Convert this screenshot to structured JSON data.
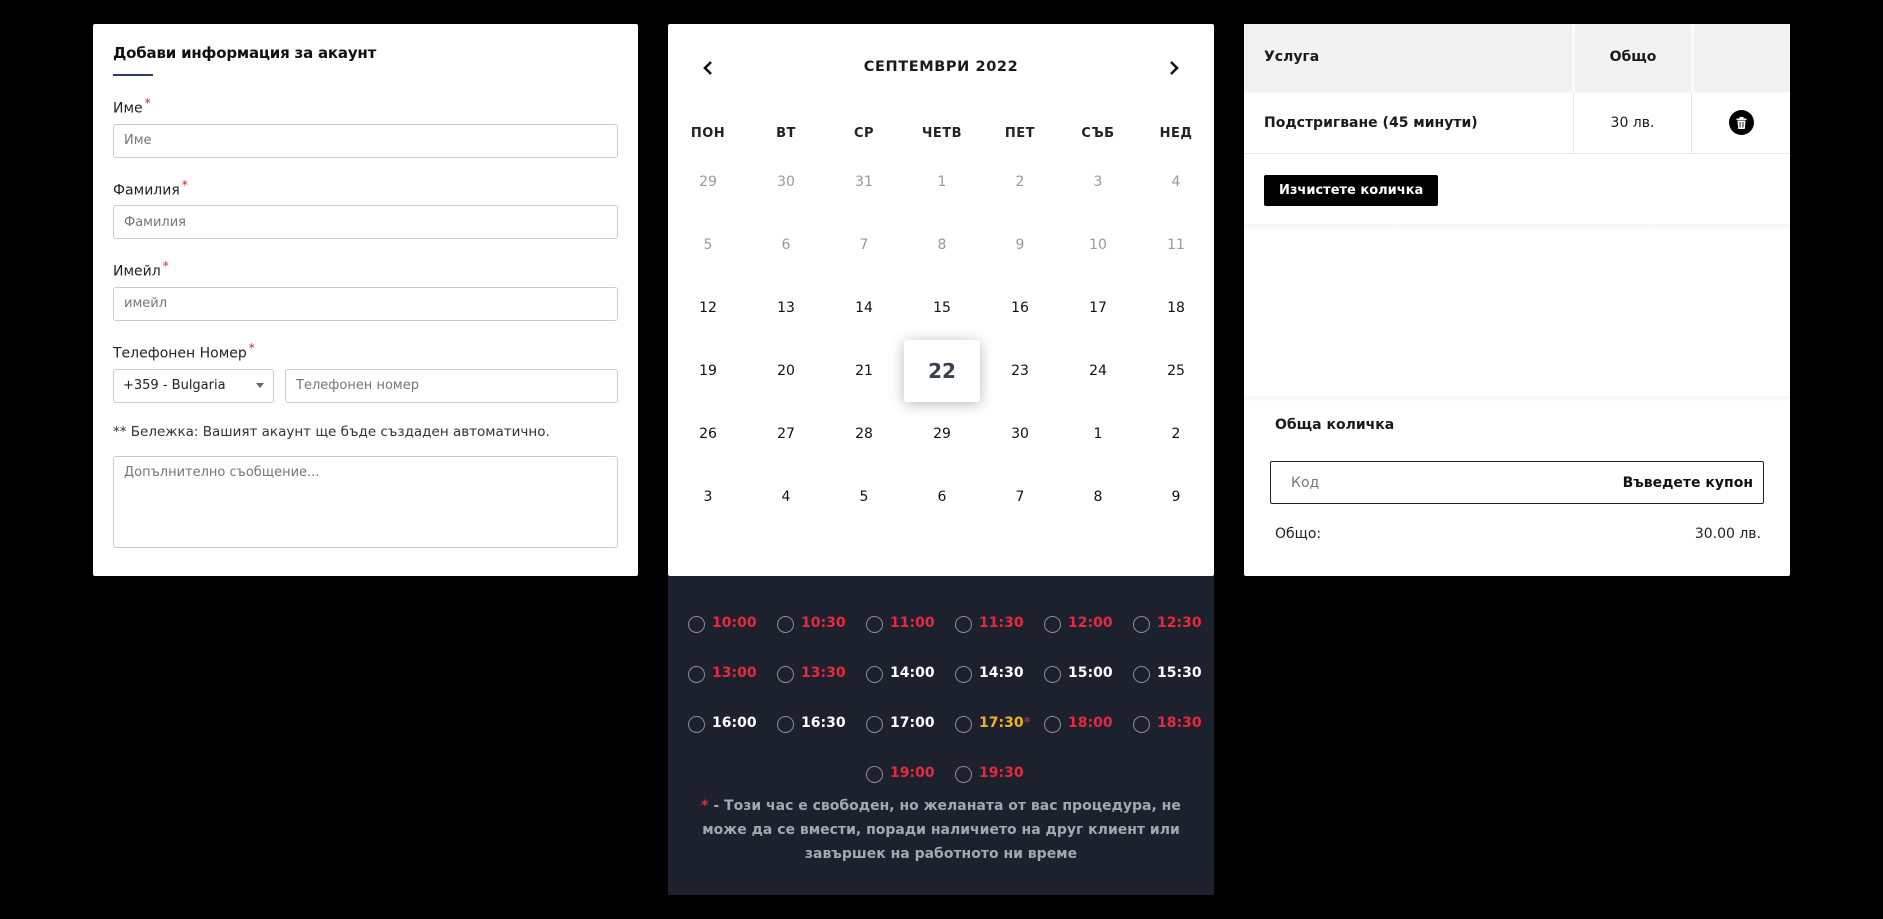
{
  "account": {
    "title": "Добави информация за акаунт",
    "required_mark": "*",
    "first_name": {
      "label": "Име",
      "placeholder": "Име"
    },
    "last_name": {
      "label": "Фамилия",
      "placeholder": "Фамилия"
    },
    "email": {
      "label": "Имейл",
      "placeholder": "имейл"
    },
    "phone": {
      "label": "Телефонен Номер",
      "country_value": "+359 - Bulgaria",
      "placeholder": "Телефонен номер"
    },
    "note": "** Бележка: Вашият акаунт ще бъде създаден автоматично.",
    "message_placeholder": "Допълнително съобщение..."
  },
  "calendar": {
    "month_label": "СЕПТЕМВРИ 2022",
    "weekdays": [
      "ПОН",
      "ВТ",
      "СР",
      "ЧЕТВ",
      "ПЕТ",
      "СЪБ",
      "НЕД"
    ],
    "selected_day": "22",
    "weeks": [
      [
        {
          "d": "29",
          "m": true
        },
        {
          "d": "30",
          "m": true
        },
        {
          "d": "31",
          "m": true
        },
        {
          "d": "1",
          "m": true
        },
        {
          "d": "2",
          "m": true
        },
        {
          "d": "3",
          "m": true
        },
        {
          "d": "4",
          "m": true
        }
      ],
      [
        {
          "d": "5",
          "m": true
        },
        {
          "d": "6",
          "m": true
        },
        {
          "d": "7",
          "m": true
        },
        {
          "d": "8",
          "m": true
        },
        {
          "d": "9",
          "m": true
        },
        {
          "d": "10",
          "m": true
        },
        {
          "d": "11",
          "m": true
        }
      ],
      [
        {
          "d": "12"
        },
        {
          "d": "13"
        },
        {
          "d": "14"
        },
        {
          "d": "15"
        },
        {
          "d": "16"
        },
        {
          "d": "17"
        },
        {
          "d": "18"
        }
      ],
      [
        {
          "d": "19"
        },
        {
          "d": "20"
        },
        {
          "d": "21"
        },
        {
          "d": "22",
          "sel": true
        },
        {
          "d": "23"
        },
        {
          "d": "24"
        },
        {
          "d": "25"
        }
      ],
      [
        {
          "d": "26"
        },
        {
          "d": "27"
        },
        {
          "d": "28"
        },
        {
          "d": "29"
        },
        {
          "d": "30"
        },
        {
          "d": "1"
        },
        {
          "d": "2"
        }
      ],
      [
        {
          "d": "3"
        },
        {
          "d": "4"
        },
        {
          "d": "5"
        },
        {
          "d": "6"
        },
        {
          "d": "7"
        },
        {
          "d": "8"
        },
        {
          "d": "9"
        }
      ]
    ]
  },
  "time_slots": {
    "rows": [
      [
        {
          "t": "10:00",
          "s": "busy"
        },
        {
          "t": "10:30",
          "s": "busy"
        },
        {
          "t": "11:00",
          "s": "busy"
        },
        {
          "t": "11:30",
          "s": "busy"
        },
        {
          "t": "12:00",
          "s": "busy"
        },
        {
          "t": "12:30",
          "s": "busy"
        }
      ],
      [
        {
          "t": "13:00",
          "s": "busy"
        },
        {
          "t": "13:30",
          "s": "busy"
        },
        {
          "t": "14:00",
          "s": "free"
        },
        {
          "t": "14:30",
          "s": "free"
        },
        {
          "t": "15:00",
          "s": "free"
        },
        {
          "t": "15:30",
          "s": "free"
        }
      ],
      [
        {
          "t": "16:00",
          "s": "free"
        },
        {
          "t": "16:30",
          "s": "free"
        },
        {
          "t": "17:00",
          "s": "free"
        },
        {
          "t": "17:30",
          "s": "warn"
        },
        {
          "t": "18:00",
          "s": "busy"
        },
        {
          "t": "18:30",
          "s": "busy"
        }
      ],
      [
        {
          "t": "19:00",
          "s": "busy"
        },
        {
          "t": "19:30",
          "s": "busy"
        }
      ]
    ],
    "note_star": "*",
    "note_text": " - Този час е свободен, но желаната от вас процедура, не може да се вмести, поради наличието на друг клиент или завършек на работното ни време",
    "colors": {
      "free": "#ffffff",
      "busy": "#e8283f",
      "warn": "#f0b323"
    }
  },
  "cart": {
    "col_service": "Услуга",
    "col_total": "Общо",
    "item": {
      "service": "Подстригване (45 минути)",
      "price": "30 лв."
    },
    "clear_button": "Изчистете количка",
    "summary_title": "Обща количка",
    "coupon_placeholder": "Код",
    "coupon_button": "Въведете купон",
    "total_label": "Общо:",
    "total_value": "30.00 лв."
  }
}
